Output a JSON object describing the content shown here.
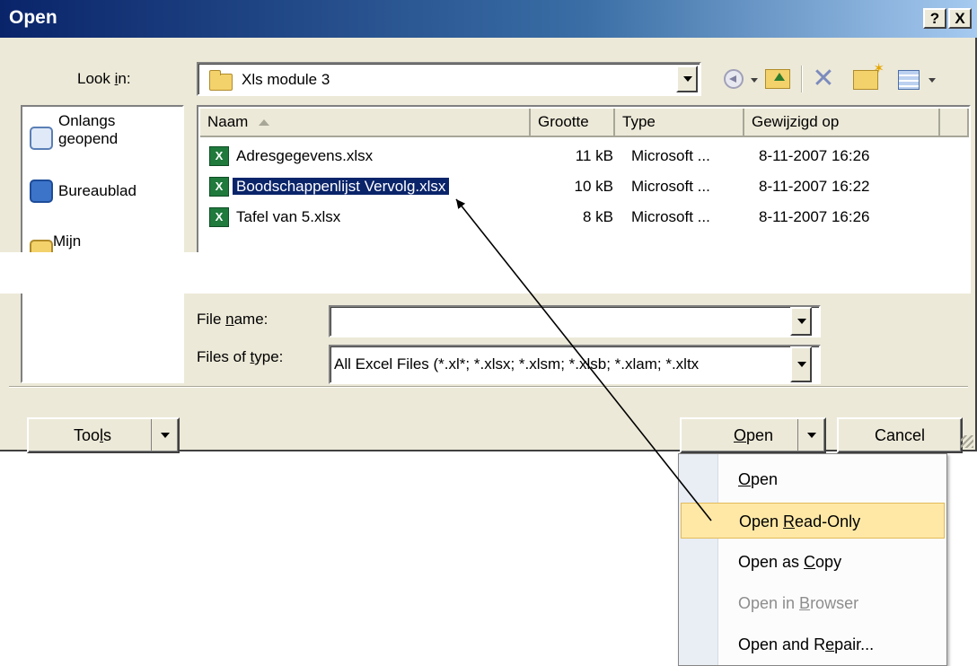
{
  "title": "Open",
  "caption_buttons": {
    "help": "?",
    "close": "X"
  },
  "look_in": {
    "label_pre": "Look ",
    "label_ul": "i",
    "label_post": "n:",
    "value": "Xls module 3"
  },
  "places": [
    {
      "line1": "Onlangs",
      "line2": "geopend"
    },
    {
      "line1": "Bureaublad",
      "line2": ""
    },
    {
      "line1": "Mijn",
      "line2": ""
    }
  ],
  "columns": {
    "name": "Naam",
    "size": "Grootte",
    "type": "Type",
    "modified": "Gewijzigd op"
  },
  "files": [
    {
      "name": "Adresgegevens.xlsx",
      "size": "11 kB",
      "type": "Microsoft ...",
      "modified": "8-11-2007 16:26"
    },
    {
      "name": "Boodschappenlijst Vervolg.xlsx",
      "size": "10 kB",
      "type": "Microsoft ...",
      "modified": "8-11-2007 16:22"
    },
    {
      "name": "Tafel van 5.xlsx",
      "size": "8 kB",
      "type": "Microsoft ...",
      "modified": "8-11-2007 16:26"
    }
  ],
  "file_name": {
    "label_pre": "File ",
    "label_ul": "n",
    "label_post": "ame:",
    "value": ""
  },
  "file_type": {
    "label_pre": "Files of ",
    "label_ul": "t",
    "label_post": "ype:",
    "value": "All Excel Files (*.xl*; *.xlsx; *.xlsm; *.xlsb; *.xlam; *.xltx"
  },
  "buttons": {
    "tools_pre": "Too",
    "tools_ul": "l",
    "tools_post": "s",
    "open_ul": "O",
    "open_post": "pen",
    "cancel": "Cancel"
  },
  "menu": [
    {
      "pre": "",
      "ul": "O",
      "post": "pen",
      "highlighted": false,
      "disabled": false
    },
    {
      "pre": "Open ",
      "ul": "R",
      "post": "ead-Only",
      "highlighted": true,
      "disabled": false
    },
    {
      "pre": "Open as ",
      "ul": "C",
      "post": "opy",
      "highlighted": false,
      "disabled": false
    },
    {
      "pre": "Open in ",
      "ul": "B",
      "post": "rowser",
      "highlighted": false,
      "disabled": true
    },
    {
      "pre": "Open and R",
      "ul": "e",
      "post": "pair...",
      "highlighted": false,
      "disabled": false
    }
  ],
  "colors": {
    "title_start": "#0a246a",
    "selection": "#0a246a",
    "menu_highlight": "#ffe8a6",
    "excel_green": "#1f7a3c"
  }
}
